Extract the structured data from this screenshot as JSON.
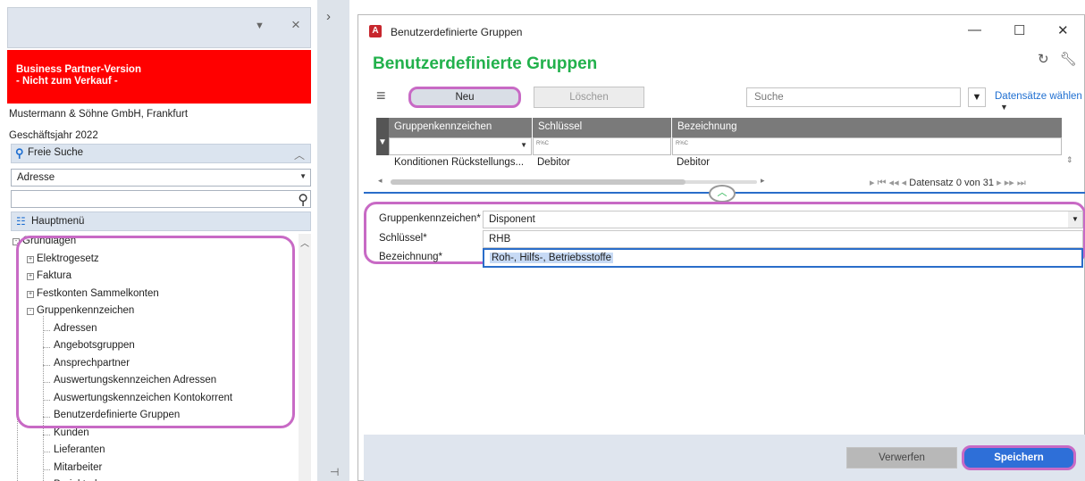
{
  "left_panel": {
    "brand_line1": "Business Partner-Version",
    "brand_line2": "- Nicht zum Verkauf -",
    "company": "Mustermann & Söhne GmbH, Frankfurt",
    "fiscal_year": "Geschäftsjahr 2022",
    "freie_suche_label": "Freie Suche",
    "address_select_value": "Adresse",
    "hauptmenu_label": "Hauptmenü",
    "tree": [
      {
        "label": "Grundlagen",
        "level": 0,
        "expander": "-"
      },
      {
        "label": "Elektrogesetz",
        "level": 1,
        "expander": "+"
      },
      {
        "label": "Faktura",
        "level": 1,
        "expander": "+"
      },
      {
        "label": "Festkonten Sammelkonten",
        "level": 1,
        "expander": "+"
      },
      {
        "label": "Gruppenkennzeichen",
        "level": 1,
        "expander": "-"
      },
      {
        "label": "Adressen",
        "level": 2,
        "expander": ""
      },
      {
        "label": "Angebotsgruppen",
        "level": 2,
        "expander": ""
      },
      {
        "label": "Ansprechpartner",
        "level": 2,
        "expander": ""
      },
      {
        "label": "Auswertungskennzeichen Adressen",
        "level": 2,
        "expander": ""
      },
      {
        "label": "Auswertungskennzeichen Kontokorrent",
        "level": 2,
        "expander": ""
      },
      {
        "label": "Benutzerdefinierte Gruppen",
        "level": 2,
        "expander": ""
      },
      {
        "label": "Kunden",
        "level": 2,
        "expander": ""
      },
      {
        "label": "Lieferanten",
        "level": 2,
        "expander": ""
      },
      {
        "label": "Mitarbeiter",
        "level": 2,
        "expander": ""
      },
      {
        "label": "Projektadressen",
        "level": 2,
        "expander": ""
      }
    ]
  },
  "window": {
    "title": "Benutzerdefinierte Gruppen",
    "header_title": "Benutzerdefinierte Gruppen",
    "toolbar": {
      "new_label": "Neu",
      "delete_label": "Löschen",
      "search_placeholder": "Suche",
      "records_label": "Datensätze wählen"
    },
    "grid": {
      "columns": [
        "Gruppenkennzeichen",
        "Schlüssel",
        "Bezeichnung"
      ],
      "filter_hint": "R%C",
      "rows": [
        [
          "Konditionen Rückstellungs...",
          "Debitor",
          "Debitor"
        ]
      ],
      "nav_label": "Datensatz 0 von 31"
    },
    "form": {
      "group_label": "Gruppenkennzeichen*",
      "group_value": "Disponent",
      "key_label": "Schlüssel*",
      "key_value": "RHB",
      "desc_label": "Bezeichnung*",
      "desc_value": "Roh-, Hilfs-, Betriebsstoffe"
    },
    "footer": {
      "discard_label": "Verwerfen",
      "save_label": "Speichern"
    }
  },
  "colors": {
    "brand_red": "#ff0000",
    "header_green": "#22b14c",
    "accent_blue": "#2e6fd8",
    "highlight_purple": "#c86ac5"
  }
}
